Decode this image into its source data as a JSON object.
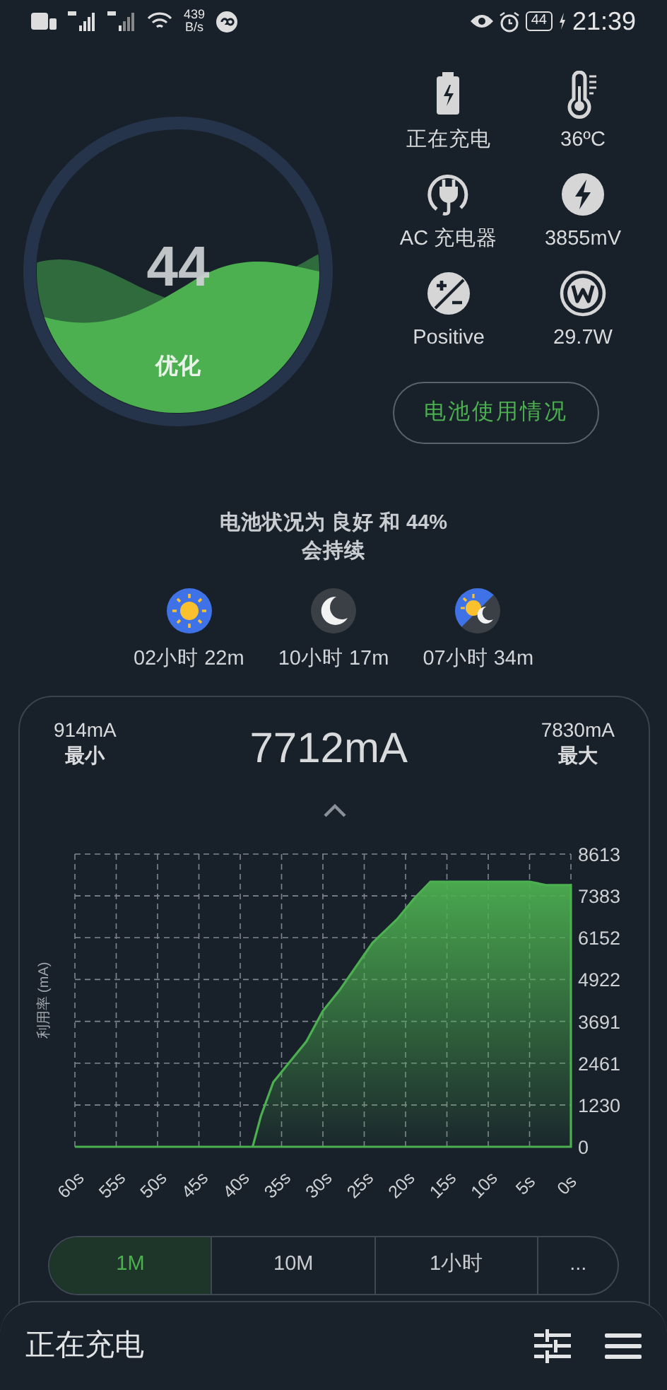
{
  "status_bar": {
    "network_speed_value": "439",
    "network_speed_unit": "B/s",
    "battery_level": "44",
    "time": "21:39"
  },
  "gauge": {
    "value": "44",
    "label": "优化"
  },
  "stats": [
    {
      "kind": "battery",
      "text": "正在充电"
    },
    {
      "kind": "temperature",
      "text": "36ºC"
    },
    {
      "kind": "plug",
      "text": "AC 充电器"
    },
    {
      "kind": "voltage",
      "text": "3855mV"
    },
    {
      "kind": "health",
      "text": "Positive"
    },
    {
      "kind": "power",
      "text": "29.7W"
    }
  ],
  "usage_button": "电池使用情况",
  "summary": {
    "lines": [
      "电池状况为 良好 和 44%",
      "会持续"
    ]
  },
  "estimates": [
    {
      "kind": "day",
      "text": "02小时 22m"
    },
    {
      "kind": "night",
      "text": "10小时 17m"
    },
    {
      "kind": "mixed",
      "text": "07小时 34m"
    }
  ],
  "current": {
    "min_value": "914mA",
    "min_label": "最小",
    "now": "7712mA",
    "max_value": "7830mA",
    "max_label": "最大"
  },
  "chart_data": {
    "type": "area",
    "ylabel": "利用率 (mA)",
    "x": [
      60,
      55,
      50,
      45,
      40,
      38.5,
      37.5,
      36,
      34,
      32,
      30,
      28,
      26,
      24,
      21,
      19,
      17,
      15,
      10,
      5,
      3,
      0
    ],
    "series": [
      {
        "color": "#4caf50",
        "values": [
          0,
          0,
          0,
          0,
          0,
          0,
          900,
          1900,
          2500,
          3100,
          4000,
          4600,
          5300,
          6000,
          6700,
          7300,
          7800,
          7800,
          7800,
          7800,
          7700,
          7700
        ]
      }
    ],
    "grid": true,
    "xlim": [
      60,
      0
    ],
    "ylim": [
      0,
      8613
    ],
    "xticks": [
      {
        "value": 60,
        "label": "60s"
      },
      {
        "value": 55,
        "label": "55s"
      },
      {
        "value": 50,
        "label": "50s"
      },
      {
        "value": 45,
        "label": "45s"
      },
      {
        "value": 40,
        "label": "40s"
      },
      {
        "value": 35,
        "label": "35s"
      },
      {
        "value": 30,
        "label": "30s"
      },
      {
        "value": 25,
        "label": "25s"
      },
      {
        "value": 20,
        "label": "20s"
      },
      {
        "value": 15,
        "label": "15s"
      },
      {
        "value": 10,
        "label": "10s"
      },
      {
        "value": 5,
        "label": "5s"
      },
      {
        "value": 0,
        "label": "0s"
      }
    ],
    "yticks": [
      0,
      1230,
      2461,
      3691,
      4922,
      6152,
      7383,
      8613
    ]
  },
  "ranges": [
    {
      "label": "1M",
      "selected": true
    },
    {
      "label": "10M",
      "selected": false
    },
    {
      "label": "1小时",
      "selected": false
    },
    {
      "label": "...",
      "selected": false
    }
  ],
  "bottom_bar": {
    "title": "正在充电"
  }
}
